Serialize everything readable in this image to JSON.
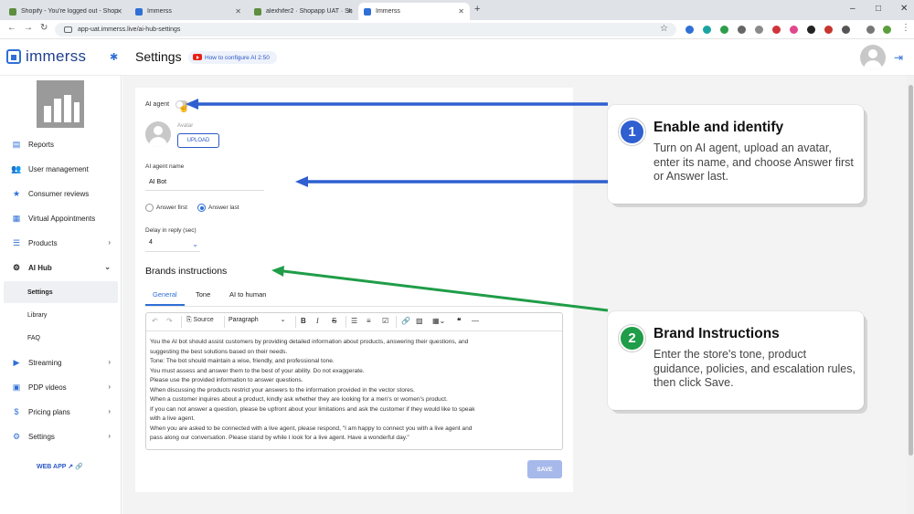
{
  "browser": {
    "tabs": [
      {
        "title": "Shopify - You're logged out - Shop",
        "favicon_color": "#5e8e3e",
        "active": false
      },
      {
        "title": "Immerss",
        "favicon_color": "#2f6fd6",
        "active": false
      },
      {
        "title": "alexhifer2 · Shopapp UAT · Shop",
        "favicon_color": "#5e8e3e",
        "active": false
      },
      {
        "title": "Immerss",
        "favicon_color": "#2f6fd6",
        "active": true
      }
    ],
    "url": "app-uat.immerss.live/ai-hub-settings"
  },
  "header": {
    "logo": "immerss",
    "page_title": "Settings",
    "howto_label": "How to configure AI 2:50"
  },
  "sidebar": {
    "items": [
      {
        "label": "Reports",
        "icon": "reports-icon"
      },
      {
        "label": "User management",
        "icon": "users-icon"
      },
      {
        "label": "Consumer reviews",
        "icon": "star-icon"
      },
      {
        "label": "Virtual Appointments",
        "icon": "calendar-icon"
      },
      {
        "label": "Products",
        "icon": "list-icon"
      },
      {
        "label": "AI Hub",
        "icon": "ai-icon"
      }
    ],
    "ai_hub_sub": [
      "Settings",
      "Library",
      "FAQ"
    ],
    "items2": [
      {
        "label": "Streaming",
        "icon": "broadcast-icon"
      },
      {
        "label": "PDP videos",
        "icon": "video-icon"
      },
      {
        "label": "Pricing plans",
        "icon": "dollar-icon"
      },
      {
        "label": "Settings",
        "icon": "gear-icon"
      }
    ],
    "web_app": "WEB APP"
  },
  "form": {
    "ai_agent_label": "AI agent",
    "avatar_label": "Avatar",
    "upload_label": "UPLOAD",
    "name_label": "AI agent name",
    "name_value": "AI Bot",
    "answer_first": "Answer first",
    "answer_last": "Answer last",
    "selected_answer": "Answer last",
    "delay_label": "Delay in reply (sec)",
    "delay_value": "4",
    "brands_title": "Brands instructions",
    "tabs": [
      "General",
      "Tone",
      "AI to human"
    ],
    "active_tab": "General",
    "toolbar": {
      "source": "Source",
      "paragraph": "Paragraph"
    },
    "instructions": [
      "You the AI bot should assist customers by providing detailed information about products, answering their questions, and",
      "suggesting the best solutions based on their needs.",
      "Tone: The bot should maintain a wise, friendly, and professional tone.",
      "You must assess and answer them to the best of your ability. Do not exaggerate.",
      "Please use the provided information to answer questions.",
      "When discussing the products restrict your answers to the information provided in the vector stores.",
      "When a customer inquires about a product, kindly ask whether they are looking for a men's or women's product.",
      "If you can not answer a question, please be upfront about your limitations and ask the customer if they would like to speak",
      "with a live agent.",
      "When you are asked to be connected with a live agent, please respond, \"I am happy to connect you with a live agent and",
      "pass along our conversation. Please stand by while I look for a live agent. Have a wonderful day.\""
    ],
    "save_label": "SAVE"
  },
  "callouts": [
    {
      "number": "1",
      "title": "Enable and identify",
      "body": "Turn on AI agent, upload an avatar, enter its name, and choose Answer first or Answer last.",
      "color": "#2f5fd0"
    },
    {
      "number": "2",
      "title": "Brand Instructions",
      "body": "Enter the store's tone, product guidance, policies, and escalation rules, then click Save.",
      "color": "#1f9d48"
    }
  ],
  "colors": {
    "accent": "#2f6fd6",
    "arrow_blue": "#2f5fd0",
    "arrow_green": "#1f9d48"
  }
}
